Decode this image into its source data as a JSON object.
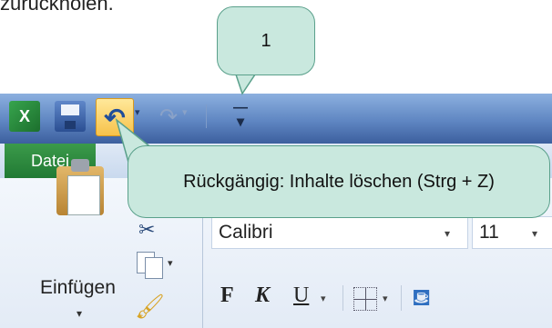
{
  "page_top_text": "zurückholen.",
  "window": {
    "app_icon_letter": "X",
    "redo_symbol": "↷",
    "customize_symbol": "₹"
  },
  "tabs": {
    "file_tab": "Datei"
  },
  "ribbon": {
    "paste_label": "Einfügen",
    "font_name": "Calibri",
    "font_size": "11",
    "bold_label": "F",
    "italic_label": "K",
    "underline_label": "U"
  },
  "callouts": {
    "number_label": "1",
    "undo_tooltip": "Rückgängig: Inhalte löschen (Strg + Z)"
  },
  "colors": {
    "callout_fill": "#c9e8de",
    "callout_border": "#5aa08b",
    "file_tab": "#217a34",
    "undo_highlight": "#f7c24a"
  },
  "icons": [
    "excel-icon",
    "save-icon",
    "undo-icon",
    "redo-icon",
    "customize-icon",
    "paste-icon",
    "cut-icon",
    "copy-icon",
    "format-painter-icon",
    "border-icon",
    "fill-color-icon"
  ]
}
